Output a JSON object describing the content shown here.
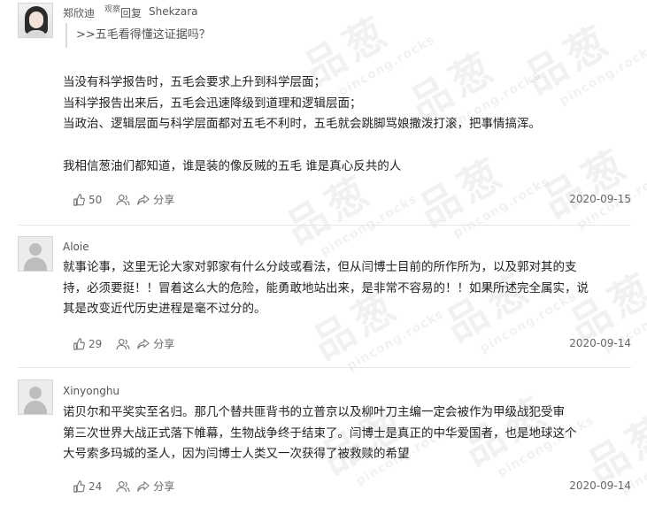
{
  "comments": [
    {
      "username": "郑欣迪",
      "user_tag": "观察",
      "reply_label": "回复",
      "reply_target": "Shekzara",
      "quote": ">>五毛看得懂这证据吗？",
      "lines": [
        "当没有科学报告时，五毛会要求上升到科学层面；",
        "当科学报告出来后，五毛会迅速降级到道理和逻辑层面；",
        "当政治、逻辑层面与科学层面都对五毛不利时，五毛就会跳脚骂娘撒泼打滚，把事情搞浑。",
        "",
        "我相信葱油们都知道，谁是装的像反贼的五毛 谁是真心反共的人"
      ],
      "likes": "50",
      "share_label": "分享",
      "date": "2020-09-15"
    },
    {
      "username": "Aloie",
      "lines": [
        "就事论事，这里无论大家对郭家有什么分歧或看法，但从闫博士目前的所作所为，以及郭对其的支",
        "持，必须要挺！！冒着这么大的危险，能勇敢地站出来，是非常不容易的！！如果所述完全属实，说",
        "其是改变近代历史进程是毫不过分的。"
      ],
      "likes": "29",
      "share_label": "分享",
      "date": "2020-09-14"
    },
    {
      "username": "Xinyonghu",
      "lines": [
        "诺贝尔和平奖实至名归。那几个替共匪背书的立普京以及柳叶刀主编一定会被作为甲级战犯受审",
        "第三次世界大战正式落下帷幕，生物战争终于结束了。闫博士是真正的中华爱国者，也是地球这个",
        "大号索多玛城的圣人，因为闫博士人类又一次获得了被救赎的希望"
      ],
      "likes": "24",
      "share_label": "分享",
      "date": "2020-09-14"
    }
  ],
  "watermark": {
    "text": "品葱",
    "subtext": "pincong.rocks"
  },
  "icons": {
    "like": "thumbs-up-icon",
    "users": "users-icon",
    "share": "share-icon"
  }
}
